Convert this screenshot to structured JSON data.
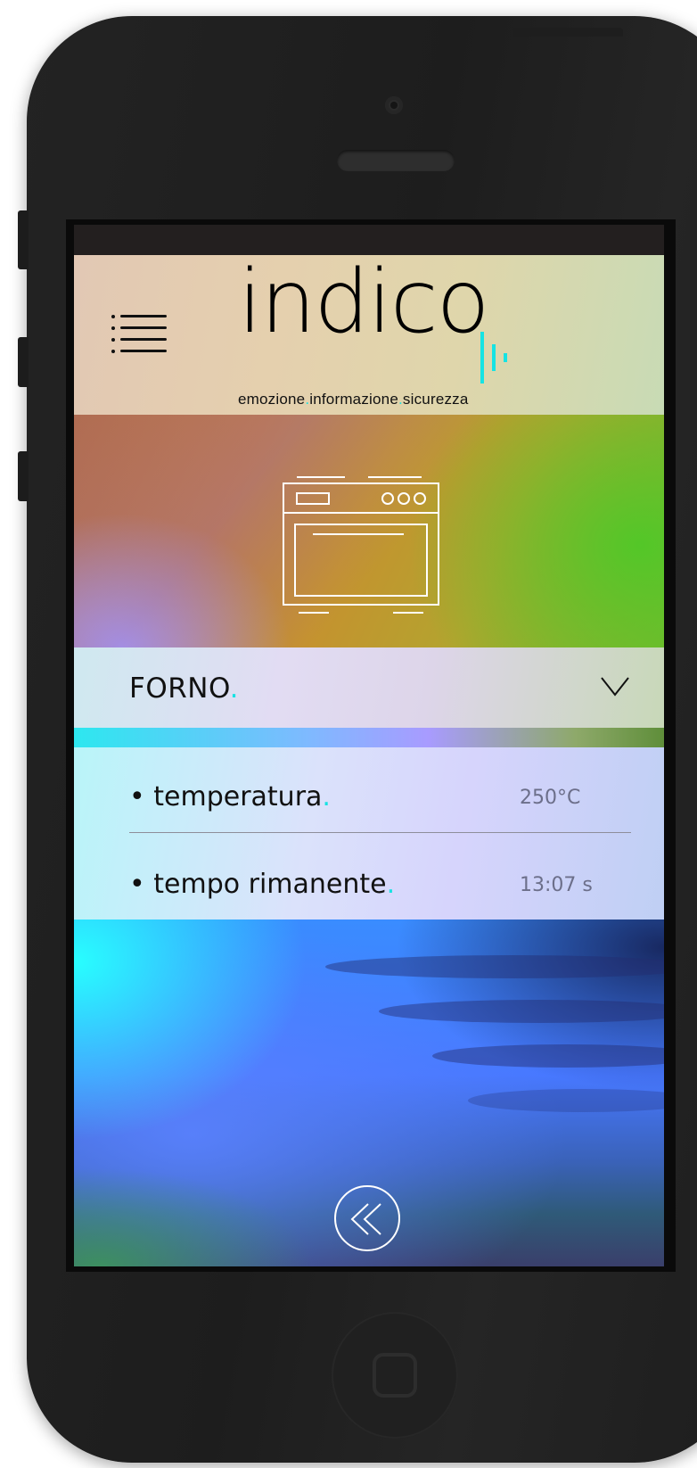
{
  "app": {
    "logo_word": "indico",
    "tagline_parts": [
      "emozione",
      ".",
      "informazione",
      ".",
      "sicurezza"
    ],
    "accent_color": "#16e3e3"
  },
  "header": {
    "menu_icon": "hamburger-menu-icon"
  },
  "hero": {
    "icon": "oven-icon"
  },
  "device": {
    "name": "FORNO",
    "dot": ".",
    "expand_icon": "chevron-down-icon"
  },
  "readings": [
    {
      "bullet": "•",
      "label": "temperatura",
      "dot": ".",
      "value": "250°C"
    },
    {
      "bullet": "•",
      "label": "tempo rimanente",
      "dot": ".",
      "value": "13:07 s"
    }
  ],
  "footer": {
    "back_icon": "double-chevron-left-icon"
  }
}
